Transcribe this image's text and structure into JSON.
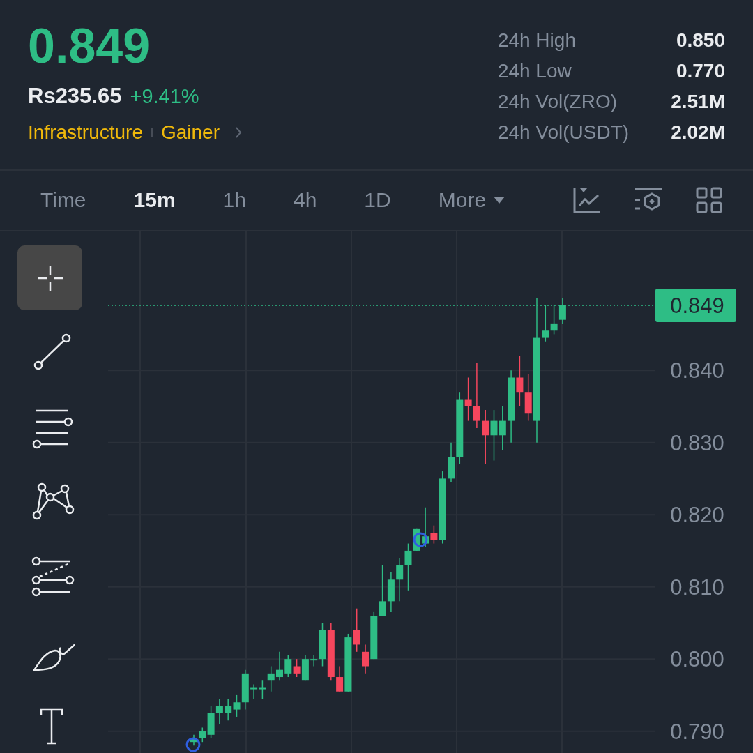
{
  "ticker": {
    "last_price": "0.849",
    "fiat_price": "Rs235.65",
    "change": "+9.41%",
    "tags": [
      "Infrastructure",
      "Gainer"
    ]
  },
  "stats": [
    {
      "label": "24h High",
      "value": "0.850"
    },
    {
      "label": "24h Low",
      "value": "0.770"
    },
    {
      "label": "24h Vol(ZRO)",
      "value": "2.51M"
    },
    {
      "label": "24h Vol(USDT)",
      "value": "2.02M"
    }
  ],
  "interval_bar": {
    "label": "Time",
    "intervals": [
      {
        "label": "15m",
        "selected": true
      },
      {
        "label": "1h",
        "selected": false
      },
      {
        "label": "4h",
        "selected": false
      },
      {
        "label": "1D",
        "selected": false
      }
    ],
    "more": "More"
  },
  "tools": [
    {
      "kind": "crosshair",
      "selected": true
    },
    {
      "kind": "trend-line",
      "selected": false
    },
    {
      "kind": "horizontal-lines",
      "selected": false
    },
    {
      "kind": "pattern",
      "selected": false
    },
    {
      "kind": "channel",
      "selected": false
    },
    {
      "kind": "brush",
      "selected": false
    },
    {
      "kind": "text",
      "selected": false
    }
  ],
  "chart": {
    "last_price_tag": "0.849",
    "price_axis": [
      "0.840",
      "0.830",
      "0.820",
      "0.810",
      "0.800",
      "0.790"
    ]
  }
}
